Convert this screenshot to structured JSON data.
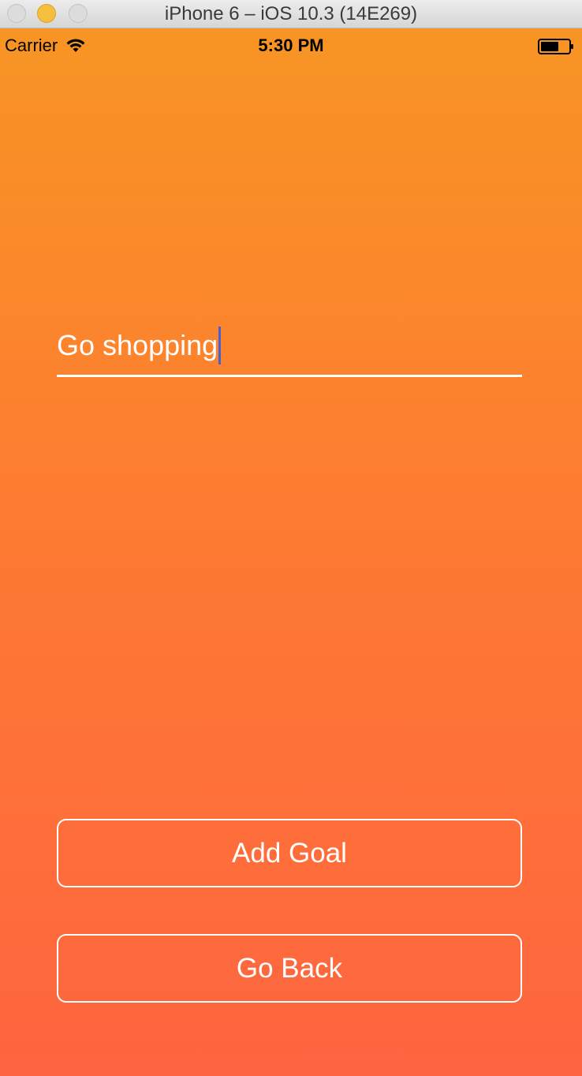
{
  "window": {
    "title": "iPhone 6 – iOS 10.3 (14E269)"
  },
  "status_bar": {
    "carrier": "Carrier",
    "time": "5:30 PM"
  },
  "goal_input": {
    "value": "Go shopping"
  },
  "buttons": {
    "add_goal": "Add Goal",
    "go_back": "Go Back"
  },
  "colors": {
    "gradient_top": "#f89524",
    "gradient_bottom": "#fe6440",
    "caret": "#4a5fd6",
    "foreground": "#ffffff"
  },
  "icons": {
    "wifi": "wifi-icon",
    "battery": "battery-icon"
  }
}
